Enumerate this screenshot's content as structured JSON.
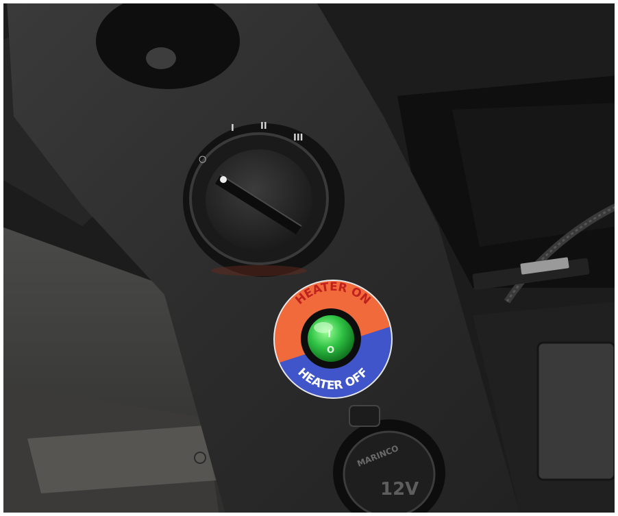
{
  "fan_dial": {
    "positions": [
      "○",
      "I",
      "II",
      "III"
    ],
    "selected": "○"
  },
  "heater_switch": {
    "label_on": "HEATER ON",
    "label_off": "HEATER OFF",
    "rocker_on_mark": "I",
    "rocker_off_mark": "O"
  },
  "power_outlet": {
    "brand": "MARINCO",
    "voltage": "12V"
  },
  "colors": {
    "dash_plastic": "#2b2b2b",
    "label_on_orange": "#f06a3c",
    "label_off_blue": "#3f55c9",
    "rocker_green": "#2fc244"
  }
}
